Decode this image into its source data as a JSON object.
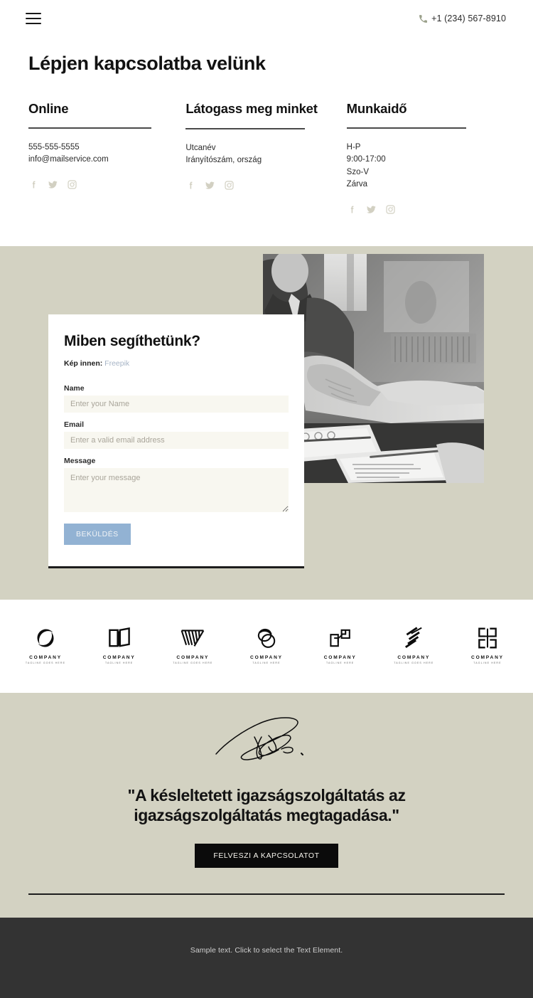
{
  "header": {
    "menu_icon": "hamburger-menu-icon",
    "phone_icon": "phone-icon",
    "phone": "+1 (234) 567-8910"
  },
  "page_title": "Lépjen kapcsolatba velünk",
  "contact_columns": [
    {
      "title": "Online",
      "lines": [
        "555-555-5555",
        "info@mailservice.com"
      ],
      "social": [
        "facebook-icon",
        "twitter-icon",
        "instagram-icon"
      ]
    },
    {
      "title": "Látogass meg minket",
      "lines": [
        "Utcanév",
        "Irányítószám, ország"
      ],
      "social": [
        "facebook-icon",
        "twitter-icon",
        "instagram-icon"
      ]
    },
    {
      "title": "Munkaidő",
      "lines": [
        "H-P",
        "9:00-17:00",
        "Szo-V",
        "Zárva"
      ],
      "social": [
        "facebook-icon",
        "twitter-icon",
        "instagram-icon"
      ]
    }
  ],
  "form": {
    "title": "Miben segíthetünk?",
    "credit_prefix": "Kép innen:",
    "credit_link": "Freepik",
    "fields": [
      {
        "label": "Name",
        "placeholder": "Enter your Name",
        "value": ""
      },
      {
        "label": "Email",
        "placeholder": "Enter a valid email address",
        "value": ""
      },
      {
        "label": "Message",
        "placeholder": "Enter your message",
        "value": ""
      }
    ],
    "submit_label": "BEKÜLDÉS",
    "photo_alt": "handshake-business-photo"
  },
  "logos": [
    {
      "mark": "circle-swirl-logo-icon",
      "name": "COMPANY",
      "tagline": "TAGLINE GOES HERE"
    },
    {
      "mark": "open-book-logo-icon",
      "name": "COMPANY",
      "tagline": "TAGLINE HERE"
    },
    {
      "mark": "chevron-stripes-logo-icon",
      "name": "COMPANY",
      "tagline": "TAGLINE GOES HERE"
    },
    {
      "mark": "overlap-circles-logo-icon",
      "name": "COMPANY",
      "tagline": "TAGLINE HERE"
    },
    {
      "mark": "squares-logo-icon",
      "name": "COMPANY",
      "tagline": "TAGLINE HERE"
    },
    {
      "mark": "diagonal-lines-logo-icon",
      "name": "COMPANY",
      "tagline": "TAGLINE GOES HERE"
    },
    {
      "mark": "bracket-blocks-logo-icon",
      "name": "COMPANY",
      "tagline": "TAGLINE HERE"
    }
  ],
  "quote": {
    "signature_icon": "handwritten-signature-icon",
    "text": "\"A késleltetett igazságszolgáltatás az igazságszolgáltatás megtagadása.\"",
    "cta_label": "FELVESZI A KAPCSOLATOT"
  },
  "footer": {
    "text": "Sample text. Click to select the Text Element."
  },
  "colors": {
    "band_background": "#d3d2c2",
    "footer_background": "#333333",
    "submit_button": "#92b2d3",
    "cta_button": "#0b0b0b",
    "link": "#a7b4c6",
    "social_icon": "#d2d0c2",
    "field_background": "#f8f7f0"
  }
}
